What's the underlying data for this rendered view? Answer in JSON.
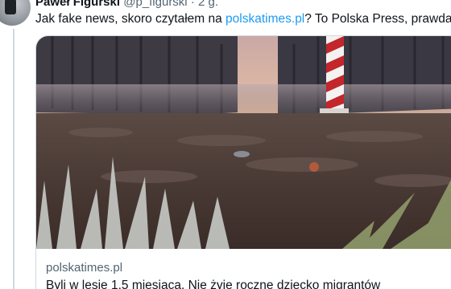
{
  "tweet": {
    "author_name": "Paweł Figurski",
    "author_handle": "@p_figurski",
    "separator": " · ",
    "time": "2 g.",
    "text_before": "Jak fake news, skoro czytałem na ",
    "link_text": "polskatimes.pl",
    "text_after": "? To Polska Press, prawda?"
  },
  "card": {
    "image_icon": "photo-forest-border",
    "domain": "polskatimes.pl",
    "title": "Byli w lesie 1,5 miesiąca. Nie żyje roczne dziecko migrantów"
  },
  "colors": {
    "link": "#1d9bf0",
    "secondary_text": "#536471",
    "border": "#cfd9de"
  }
}
